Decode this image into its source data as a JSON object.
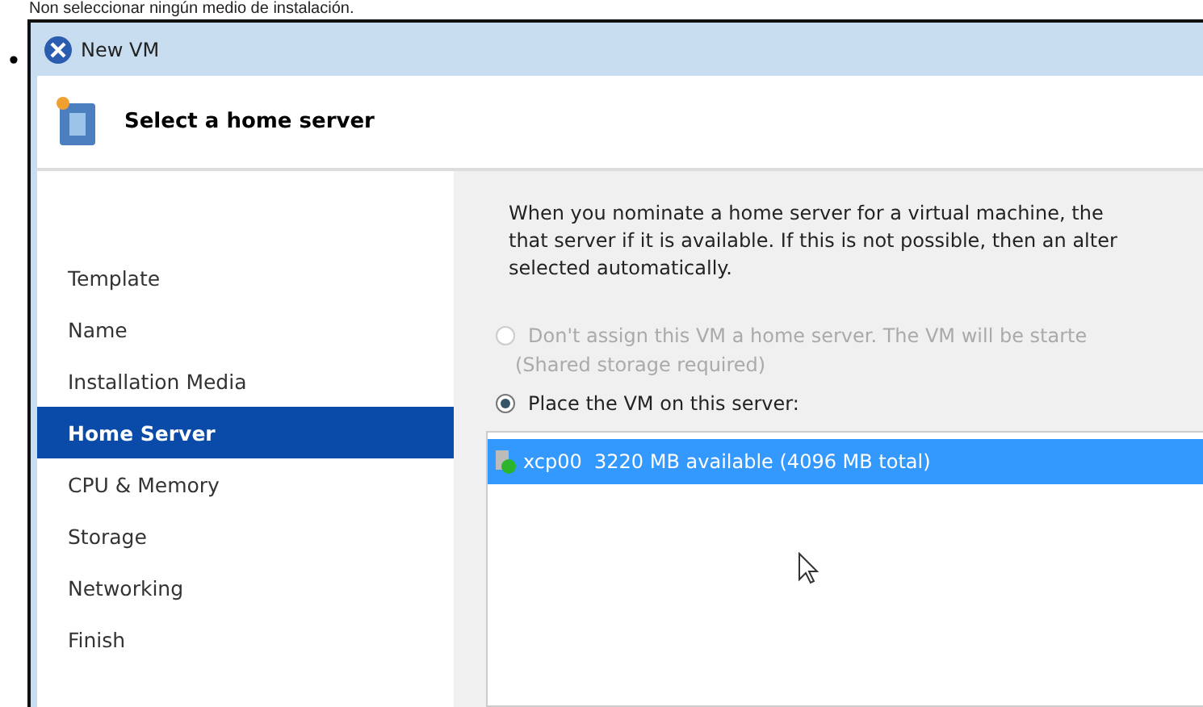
{
  "caption": "Non seleccionar ningún medio de instalación.",
  "bullet": "•",
  "window": {
    "title": "New VM"
  },
  "header": {
    "title": "Select a home server"
  },
  "nav": [
    {
      "label": "Template",
      "selected": false
    },
    {
      "label": "Name",
      "selected": false
    },
    {
      "label": "Installation Media",
      "selected": false
    },
    {
      "label": "Home Server",
      "selected": true
    },
    {
      "label": "CPU & Memory",
      "selected": false
    },
    {
      "label": "Storage",
      "selected": false
    },
    {
      "label": "Networking",
      "selected": false
    },
    {
      "label": "Finish",
      "selected": false
    }
  ],
  "description": [
    "When you nominate a home server for a virtual machine, the",
    "that server if it is available. If this is not possible, then an alter",
    "selected automatically."
  ],
  "options": [
    {
      "label": "Don't assign this VM a home server. The VM will be starte",
      "note": "(Shared storage required)",
      "selected": false,
      "disabled": true
    },
    {
      "label": "Place the VM on this server:",
      "selected": true,
      "disabled": false
    }
  ],
  "servers": [
    {
      "name": "xcp00",
      "memory": "3220 MB available (4096 MB total)",
      "selected": true
    }
  ]
}
